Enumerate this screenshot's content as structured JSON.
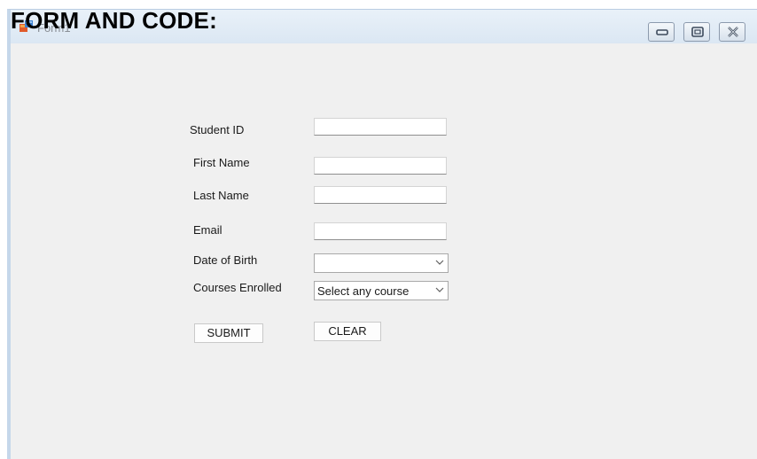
{
  "window": {
    "title": "Form1",
    "icon": "form-app-icon",
    "controls": [
      "minimize-icon",
      "maximize-icon",
      "close-icon"
    ]
  },
  "page_heading": "FORM AND CODE:",
  "form": {
    "student_id": {
      "label": "Student ID",
      "value": ""
    },
    "first_name": {
      "label": "First Name",
      "value": ""
    },
    "last_name": {
      "label": "Last Name",
      "value": ""
    },
    "email": {
      "label": "Email",
      "value": ""
    },
    "date_of_birth": {
      "label": "Date of Birth",
      "value": ""
    },
    "courses": {
      "label": "Courses Enrolled",
      "selected": "Select any course"
    },
    "submit_label": "SUBMIT",
    "clear_label": "CLEAR"
  },
  "colors": {
    "form_background": "#f0f0f0",
    "titlebar": "#dbe7f3",
    "window_border": "#c5d7ea"
  }
}
